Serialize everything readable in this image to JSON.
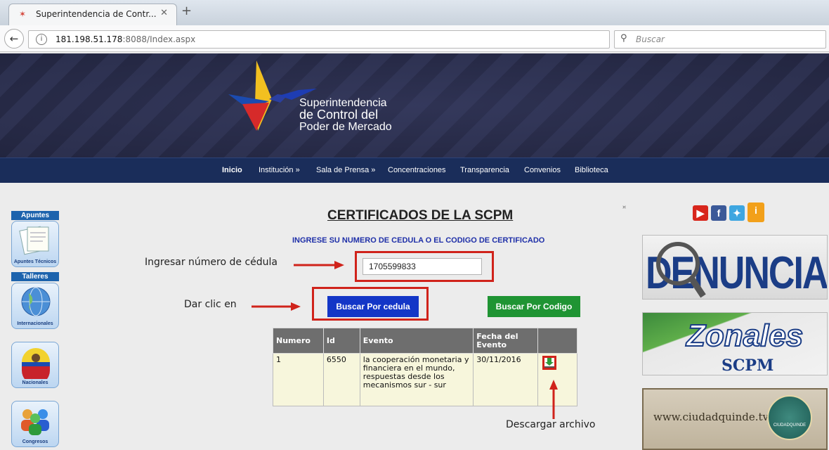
{
  "browser": {
    "tab_title": "Superintendencia de Contr...",
    "url_host": "181.198.51.178",
    "url_path": ":8088/Index.aspx",
    "search_placeholder": "Buscar"
  },
  "header": {
    "logo_line1": "Superintendencia",
    "logo_line2": "de Control del",
    "logo_line3": "Poder de Mercado",
    "menu": [
      {
        "label": "Inicio"
      },
      {
        "label": "Institución »"
      },
      {
        "label": "Sala de Prensa »"
      },
      {
        "label": "Concentraciones"
      },
      {
        "label": "Transparencia"
      },
      {
        "label": "Convenios"
      },
      {
        "label": "Biblioteca"
      }
    ]
  },
  "sidebar_left": {
    "apuntes_label": "Apuntes",
    "apuntes_tile": "Apuntes Técnicos",
    "talleres_label": "Talleres",
    "internacionales_tile": "Internacionales",
    "nacionales_tile": "Nacionales",
    "congresos_tile": "Congresos"
  },
  "main": {
    "title": "CERTIFICADOS DE LA SCPM",
    "instruction": "INGRESE SU NUMERO DE CEDULA O EL CODIGO DE CERTIFICADO",
    "cedula_value": "1705599833",
    "btn_cedula": "Buscar Por cedula",
    "btn_codigo": "Buscar Por Codigo",
    "table": {
      "headers": [
        "Numero",
        "Id",
        "Evento",
        "Fecha del Evento",
        ""
      ],
      "rows": [
        {
          "numero": "1",
          "id": "6550",
          "evento": "la cooperación monetaria y financiera en el mundo, respuestas desde los mecanismos sur - sur",
          "fecha": "30/11/2016"
        }
      ]
    }
  },
  "annotations": {
    "hint_cedula": "Ingresar número de cédula",
    "hint_clic": "Dar clic en",
    "hint_descargar": "Descargar archivo",
    "arrow_color": "#d0231b"
  },
  "sidebar_right": {
    "denuncias": "DENUNCIAS",
    "zonales": "Zonales",
    "zonales_sub": "SCPM",
    "ciudad": "www.ciudadquinde.tv",
    "ciudad_logo": "CIUDADQUINDE"
  },
  "colors": {
    "menu_bg": "#1a2d5a",
    "btn_cedula": "#1336c7",
    "btn_codigo": "#1f9433",
    "instruction": "#1e2fa8",
    "highlight": "#d0231b"
  }
}
